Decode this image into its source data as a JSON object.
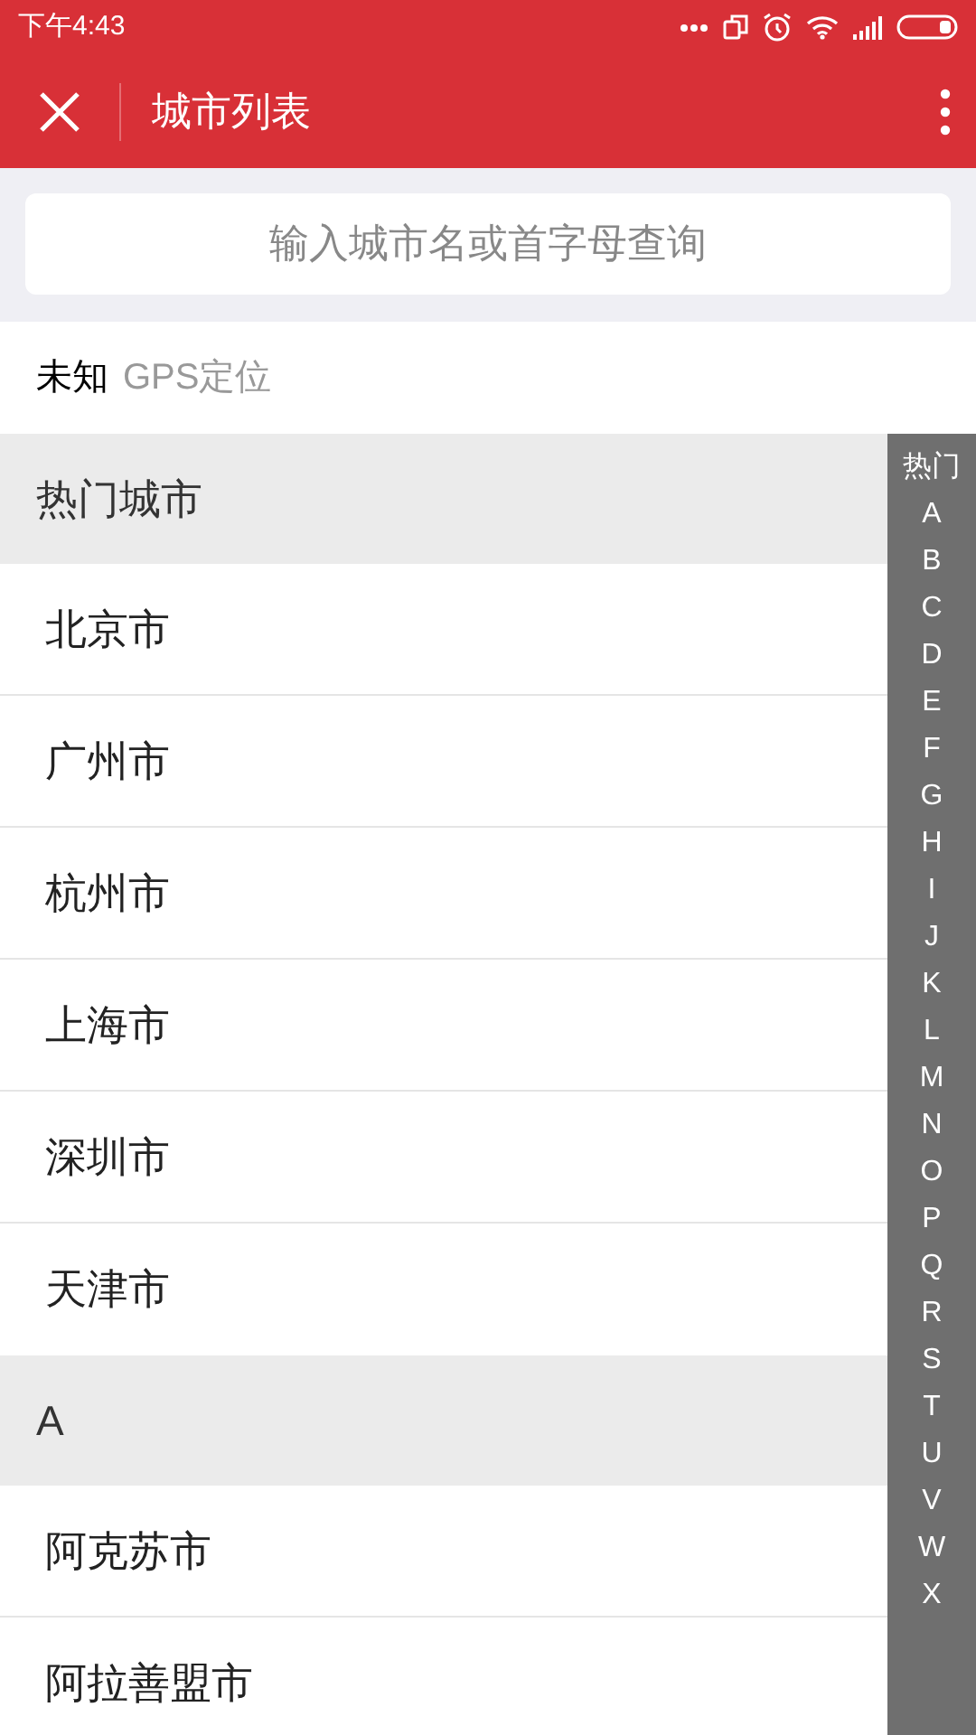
{
  "status_bar": {
    "time": "下午4:43"
  },
  "header": {
    "title": "城市列表"
  },
  "search": {
    "placeholder": "输入城市名或首字母查询"
  },
  "location": {
    "city": "未知",
    "label": "GPS定位"
  },
  "sections": [
    {
      "title": "热门城市",
      "cities": [
        "北京市",
        "广州市",
        "杭州市",
        "上海市",
        "深圳市",
        "天津市"
      ]
    },
    {
      "title": "A",
      "cities": [
        "阿克苏市",
        "阿拉善盟市"
      ]
    }
  ],
  "index": [
    "热门",
    "A",
    "B",
    "C",
    "D",
    "E",
    "F",
    "G",
    "H",
    "I",
    "J",
    "K",
    "L",
    "M",
    "N",
    "O",
    "P",
    "Q",
    "R",
    "S",
    "T",
    "U",
    "V",
    "W",
    "X"
  ]
}
